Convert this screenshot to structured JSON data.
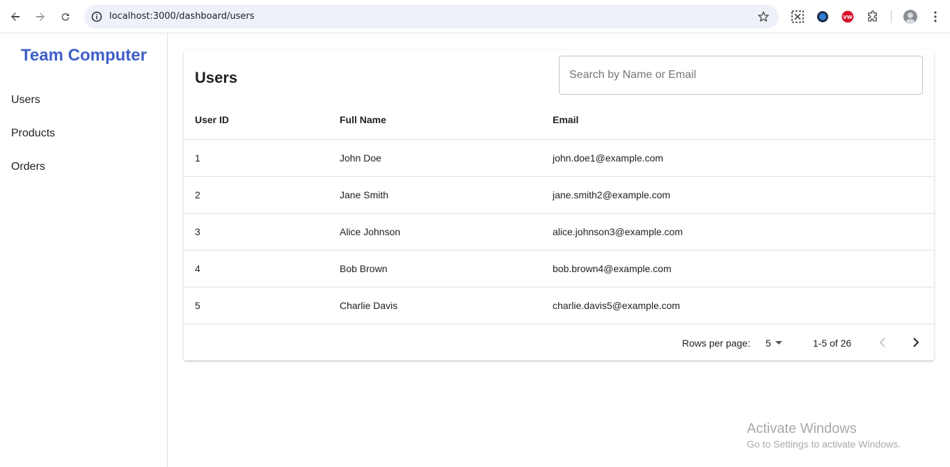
{
  "browser": {
    "url": "localhost:3000/dashboard/users",
    "icons": [
      "back-arrow-icon",
      "forward-arrow-icon",
      "reload-icon",
      "info-icon",
      "star-icon",
      "screenshot-extension-icon",
      "blue-extension-icon",
      "vw-extension-icon",
      "puzzle-icon",
      "profile-avatar-icon",
      "kebab-menu-icon"
    ],
    "ext_vw_label": "VW"
  },
  "sidebar": {
    "brand": "Team Computer",
    "brand_color": "#3f5fc9",
    "items": [
      {
        "label": "Users"
      },
      {
        "label": "Products"
      },
      {
        "label": "Orders"
      }
    ]
  },
  "main": {
    "title": "Users",
    "search": {
      "placeholder": "Search by Name or Email",
      "value": ""
    },
    "table": {
      "headers": [
        "User ID",
        "Full Name",
        "Email"
      ],
      "rows": [
        {
          "id": "1",
          "name": "John Doe",
          "email": "john.doe1@example.com"
        },
        {
          "id": "2",
          "name": "Jane Smith",
          "email": "jane.smith2@example.com"
        },
        {
          "id": "3",
          "name": "Alice Johnson",
          "email": "alice.johnson3@example.com"
        },
        {
          "id": "4",
          "name": "Bob Brown",
          "email": "bob.brown4@example.com"
        },
        {
          "id": "5",
          "name": "Charlie Davis",
          "email": "charlie.davis5@example.com"
        }
      ]
    },
    "pagination": {
      "rows_per_page_label": "Rows per page:",
      "rows_per_page_value": "5",
      "range": "1-5 of 26"
    }
  },
  "watermark": {
    "line1": "Activate Windows",
    "line2": "Go to Settings to activate Windows."
  }
}
